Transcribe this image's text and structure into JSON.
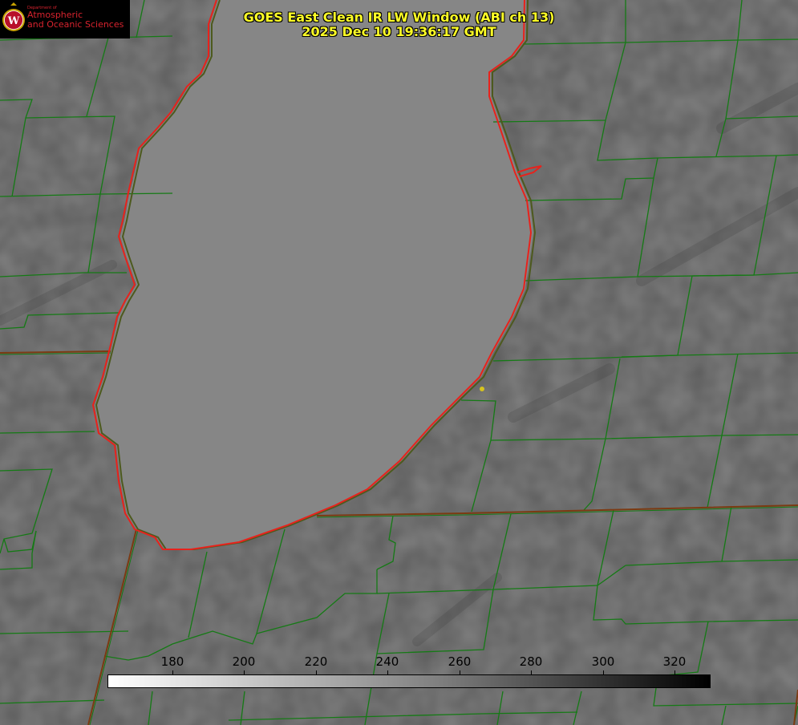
{
  "title": {
    "line1": "GOES East Clean IR LW Window (ABI ch 13)",
    "line2": "2025 Dec 10 19:36:17 GMT"
  },
  "logo": {
    "department": "Department of",
    "line1": "Atmospheric",
    "line2": "and Oceanic Sciences",
    "emblem_letter": "W"
  },
  "colorbar": {
    "ticks": [
      "180",
      "200",
      "220",
      "240",
      "260",
      "280",
      "300",
      "320"
    ]
  },
  "colors": {
    "county_lines": "#157a15",
    "state_lines": "#8b4513",
    "lake_outline": "#e8221c",
    "title_text": "#ffff26",
    "marker": "#d6c31e"
  }
}
